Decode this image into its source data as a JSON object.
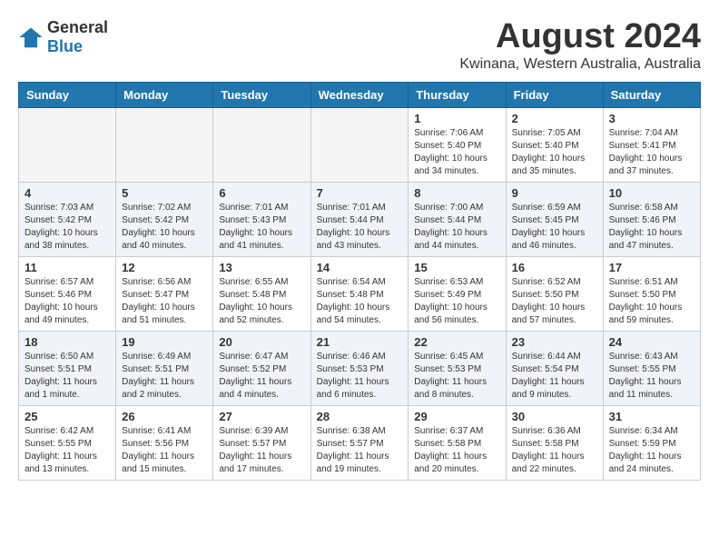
{
  "header": {
    "logo_general": "General",
    "logo_blue": "Blue",
    "month_year": "August 2024",
    "location": "Kwinana, Western Australia, Australia"
  },
  "columns": [
    "Sunday",
    "Monday",
    "Tuesday",
    "Wednesday",
    "Thursday",
    "Friday",
    "Saturday"
  ],
  "weeks": [
    [
      {
        "day": "",
        "info": ""
      },
      {
        "day": "",
        "info": ""
      },
      {
        "day": "",
        "info": ""
      },
      {
        "day": "",
        "info": ""
      },
      {
        "day": "1",
        "info": "Sunrise: 7:06 AM\nSunset: 5:40 PM\nDaylight: 10 hours\nand 34 minutes."
      },
      {
        "day": "2",
        "info": "Sunrise: 7:05 AM\nSunset: 5:40 PM\nDaylight: 10 hours\nand 35 minutes."
      },
      {
        "day": "3",
        "info": "Sunrise: 7:04 AM\nSunset: 5:41 PM\nDaylight: 10 hours\nand 37 minutes."
      }
    ],
    [
      {
        "day": "4",
        "info": "Sunrise: 7:03 AM\nSunset: 5:42 PM\nDaylight: 10 hours\nand 38 minutes."
      },
      {
        "day": "5",
        "info": "Sunrise: 7:02 AM\nSunset: 5:42 PM\nDaylight: 10 hours\nand 40 minutes."
      },
      {
        "day": "6",
        "info": "Sunrise: 7:01 AM\nSunset: 5:43 PM\nDaylight: 10 hours\nand 41 minutes."
      },
      {
        "day": "7",
        "info": "Sunrise: 7:01 AM\nSunset: 5:44 PM\nDaylight: 10 hours\nand 43 minutes."
      },
      {
        "day": "8",
        "info": "Sunrise: 7:00 AM\nSunset: 5:44 PM\nDaylight: 10 hours\nand 44 minutes."
      },
      {
        "day": "9",
        "info": "Sunrise: 6:59 AM\nSunset: 5:45 PM\nDaylight: 10 hours\nand 46 minutes."
      },
      {
        "day": "10",
        "info": "Sunrise: 6:58 AM\nSunset: 5:46 PM\nDaylight: 10 hours\nand 47 minutes."
      }
    ],
    [
      {
        "day": "11",
        "info": "Sunrise: 6:57 AM\nSunset: 5:46 PM\nDaylight: 10 hours\nand 49 minutes."
      },
      {
        "day": "12",
        "info": "Sunrise: 6:56 AM\nSunset: 5:47 PM\nDaylight: 10 hours\nand 51 minutes."
      },
      {
        "day": "13",
        "info": "Sunrise: 6:55 AM\nSunset: 5:48 PM\nDaylight: 10 hours\nand 52 minutes."
      },
      {
        "day": "14",
        "info": "Sunrise: 6:54 AM\nSunset: 5:48 PM\nDaylight: 10 hours\nand 54 minutes."
      },
      {
        "day": "15",
        "info": "Sunrise: 6:53 AM\nSunset: 5:49 PM\nDaylight: 10 hours\nand 56 minutes."
      },
      {
        "day": "16",
        "info": "Sunrise: 6:52 AM\nSunset: 5:50 PM\nDaylight: 10 hours\nand 57 minutes."
      },
      {
        "day": "17",
        "info": "Sunrise: 6:51 AM\nSunset: 5:50 PM\nDaylight: 10 hours\nand 59 minutes."
      }
    ],
    [
      {
        "day": "18",
        "info": "Sunrise: 6:50 AM\nSunset: 5:51 PM\nDaylight: 11 hours\nand 1 minute."
      },
      {
        "day": "19",
        "info": "Sunrise: 6:49 AM\nSunset: 5:51 PM\nDaylight: 11 hours\nand 2 minutes."
      },
      {
        "day": "20",
        "info": "Sunrise: 6:47 AM\nSunset: 5:52 PM\nDaylight: 11 hours\nand 4 minutes."
      },
      {
        "day": "21",
        "info": "Sunrise: 6:46 AM\nSunset: 5:53 PM\nDaylight: 11 hours\nand 6 minutes."
      },
      {
        "day": "22",
        "info": "Sunrise: 6:45 AM\nSunset: 5:53 PM\nDaylight: 11 hours\nand 8 minutes."
      },
      {
        "day": "23",
        "info": "Sunrise: 6:44 AM\nSunset: 5:54 PM\nDaylight: 11 hours\nand 9 minutes."
      },
      {
        "day": "24",
        "info": "Sunrise: 6:43 AM\nSunset: 5:55 PM\nDaylight: 11 hours\nand 11 minutes."
      }
    ],
    [
      {
        "day": "25",
        "info": "Sunrise: 6:42 AM\nSunset: 5:55 PM\nDaylight: 11 hours\nand 13 minutes."
      },
      {
        "day": "26",
        "info": "Sunrise: 6:41 AM\nSunset: 5:56 PM\nDaylight: 11 hours\nand 15 minutes."
      },
      {
        "day": "27",
        "info": "Sunrise: 6:39 AM\nSunset: 5:57 PM\nDaylight: 11 hours\nand 17 minutes."
      },
      {
        "day": "28",
        "info": "Sunrise: 6:38 AM\nSunset: 5:57 PM\nDaylight: 11 hours\nand 19 minutes."
      },
      {
        "day": "29",
        "info": "Sunrise: 6:37 AM\nSunset: 5:58 PM\nDaylight: 11 hours\nand 20 minutes."
      },
      {
        "day": "30",
        "info": "Sunrise: 6:36 AM\nSunset: 5:58 PM\nDaylight: 11 hours\nand 22 minutes."
      },
      {
        "day": "31",
        "info": "Sunrise: 6:34 AM\nSunset: 5:59 PM\nDaylight: 11 hours\nand 24 minutes."
      }
    ]
  ]
}
